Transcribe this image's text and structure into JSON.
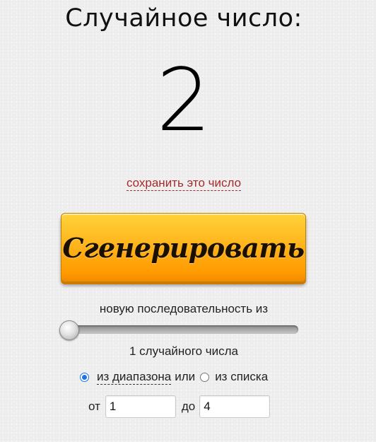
{
  "header": {
    "title": "Случайное число:"
  },
  "result": {
    "value": "2"
  },
  "save_link": {
    "label": "сохранить это число"
  },
  "generate_button": {
    "label": "Сгенерировать"
  },
  "sequence": {
    "label": "новую последовательность из",
    "slider_value": 1,
    "count_label": "1 случайного числа"
  },
  "mode": {
    "option_range": "из диапазона",
    "separator": "или",
    "option_list": "из списка",
    "selected": "range"
  },
  "range": {
    "from_label": "от",
    "from_value": "1",
    "to_label": "до",
    "to_value": "4"
  },
  "colors": {
    "link": "#a52a2a",
    "button_top": "#ffd23a",
    "button_bottom": "#ff9a00",
    "radio_accent": "#1a73e8"
  }
}
